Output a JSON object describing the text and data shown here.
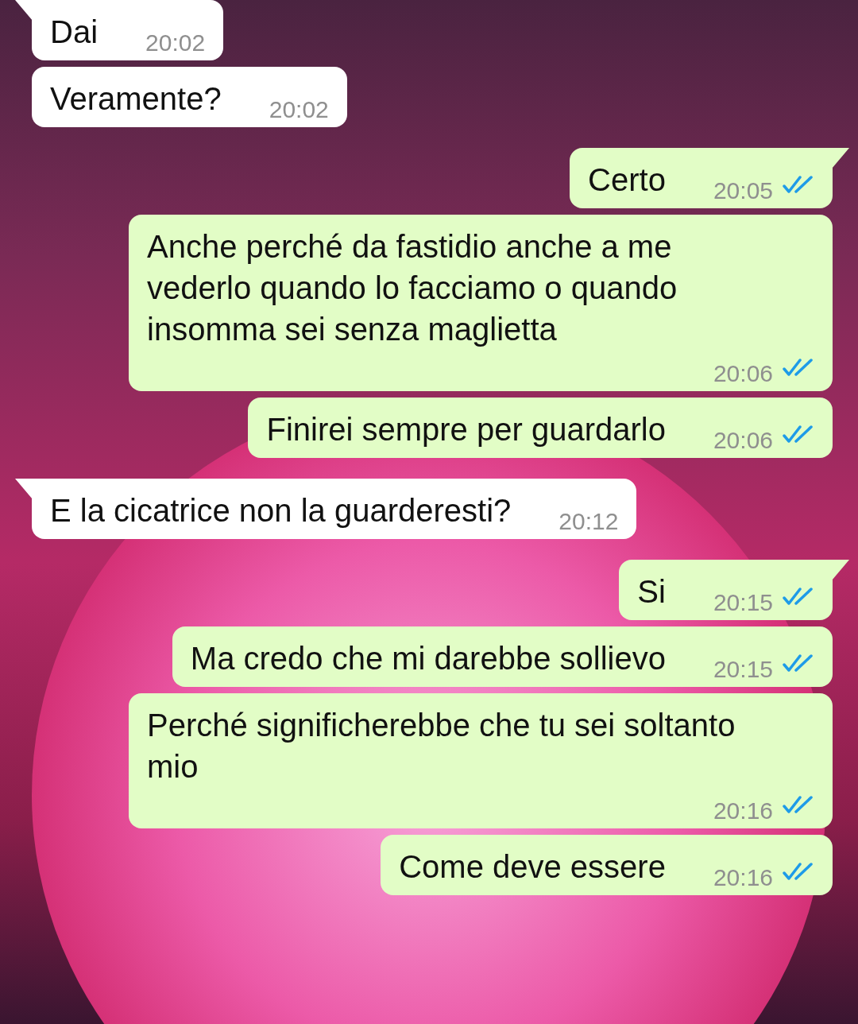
{
  "messages": [
    {
      "outgoing": false,
      "tail": true,
      "text": "Dai",
      "time": "20:02"
    },
    {
      "outgoing": false,
      "tail": false,
      "text": "Veramente?",
      "time": "20:02"
    },
    {
      "outgoing": true,
      "tail": true,
      "text": "Certo",
      "time": "20:05",
      "read": true
    },
    {
      "outgoing": true,
      "tail": false,
      "text": "Anche perché da fastidio anche a me vederlo quando lo facciamo o quando insomma sei senza maglietta",
      "time": "20:06",
      "read": true
    },
    {
      "outgoing": true,
      "tail": false,
      "text": "Finirei sempre per guardarlo",
      "time": "20:06",
      "read": true
    },
    {
      "outgoing": false,
      "tail": true,
      "text": "E la cicatrice non la guarderesti?",
      "time": "20:12"
    },
    {
      "outgoing": true,
      "tail": true,
      "text": "Si",
      "time": "20:15",
      "read": true
    },
    {
      "outgoing": true,
      "tail": false,
      "text": "Ma credo che mi darebbe sollievo",
      "time": "20:15",
      "read": true
    },
    {
      "outgoing": true,
      "tail": false,
      "text": "Perché significherebbe che tu sei soltanto mio",
      "time": "20:16",
      "read": true
    },
    {
      "outgoing": true,
      "tail": false,
      "text": "Come deve essere",
      "time": "20:16",
      "read": true
    }
  ]
}
